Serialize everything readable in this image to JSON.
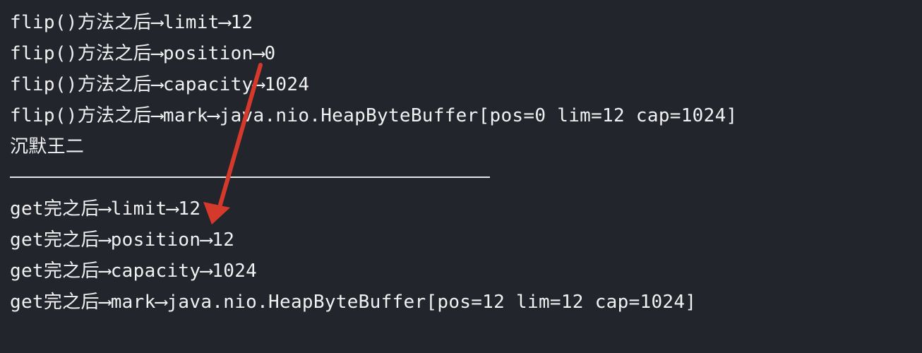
{
  "console": {
    "flip_lines": [
      "flip()方法之后⟶limit⟶12",
      "flip()方法之后⟶position⟶0",
      "flip()方法之后⟶capacity⟶1024",
      "flip()方法之后⟶mark⟶java.nio.HeapByteBuffer[pos=0 lim=12 cap=1024]"
    ],
    "name_line": "沉默王二",
    "get_lines": [
      "get完之后⟶limit⟶12",
      "get完之后⟶position⟶12",
      "get完之后⟶capacity⟶1024",
      "get完之后⟶mark⟶java.nio.HeapByteBuffer[pos=12 lim=12 cap=1024]"
    ]
  },
  "colors": {
    "background": "#22252c",
    "text": "#f1f1f1",
    "annotation_arrow": "#d5392b"
  },
  "icons": {
    "annotation": "red-arrow-icon"
  }
}
